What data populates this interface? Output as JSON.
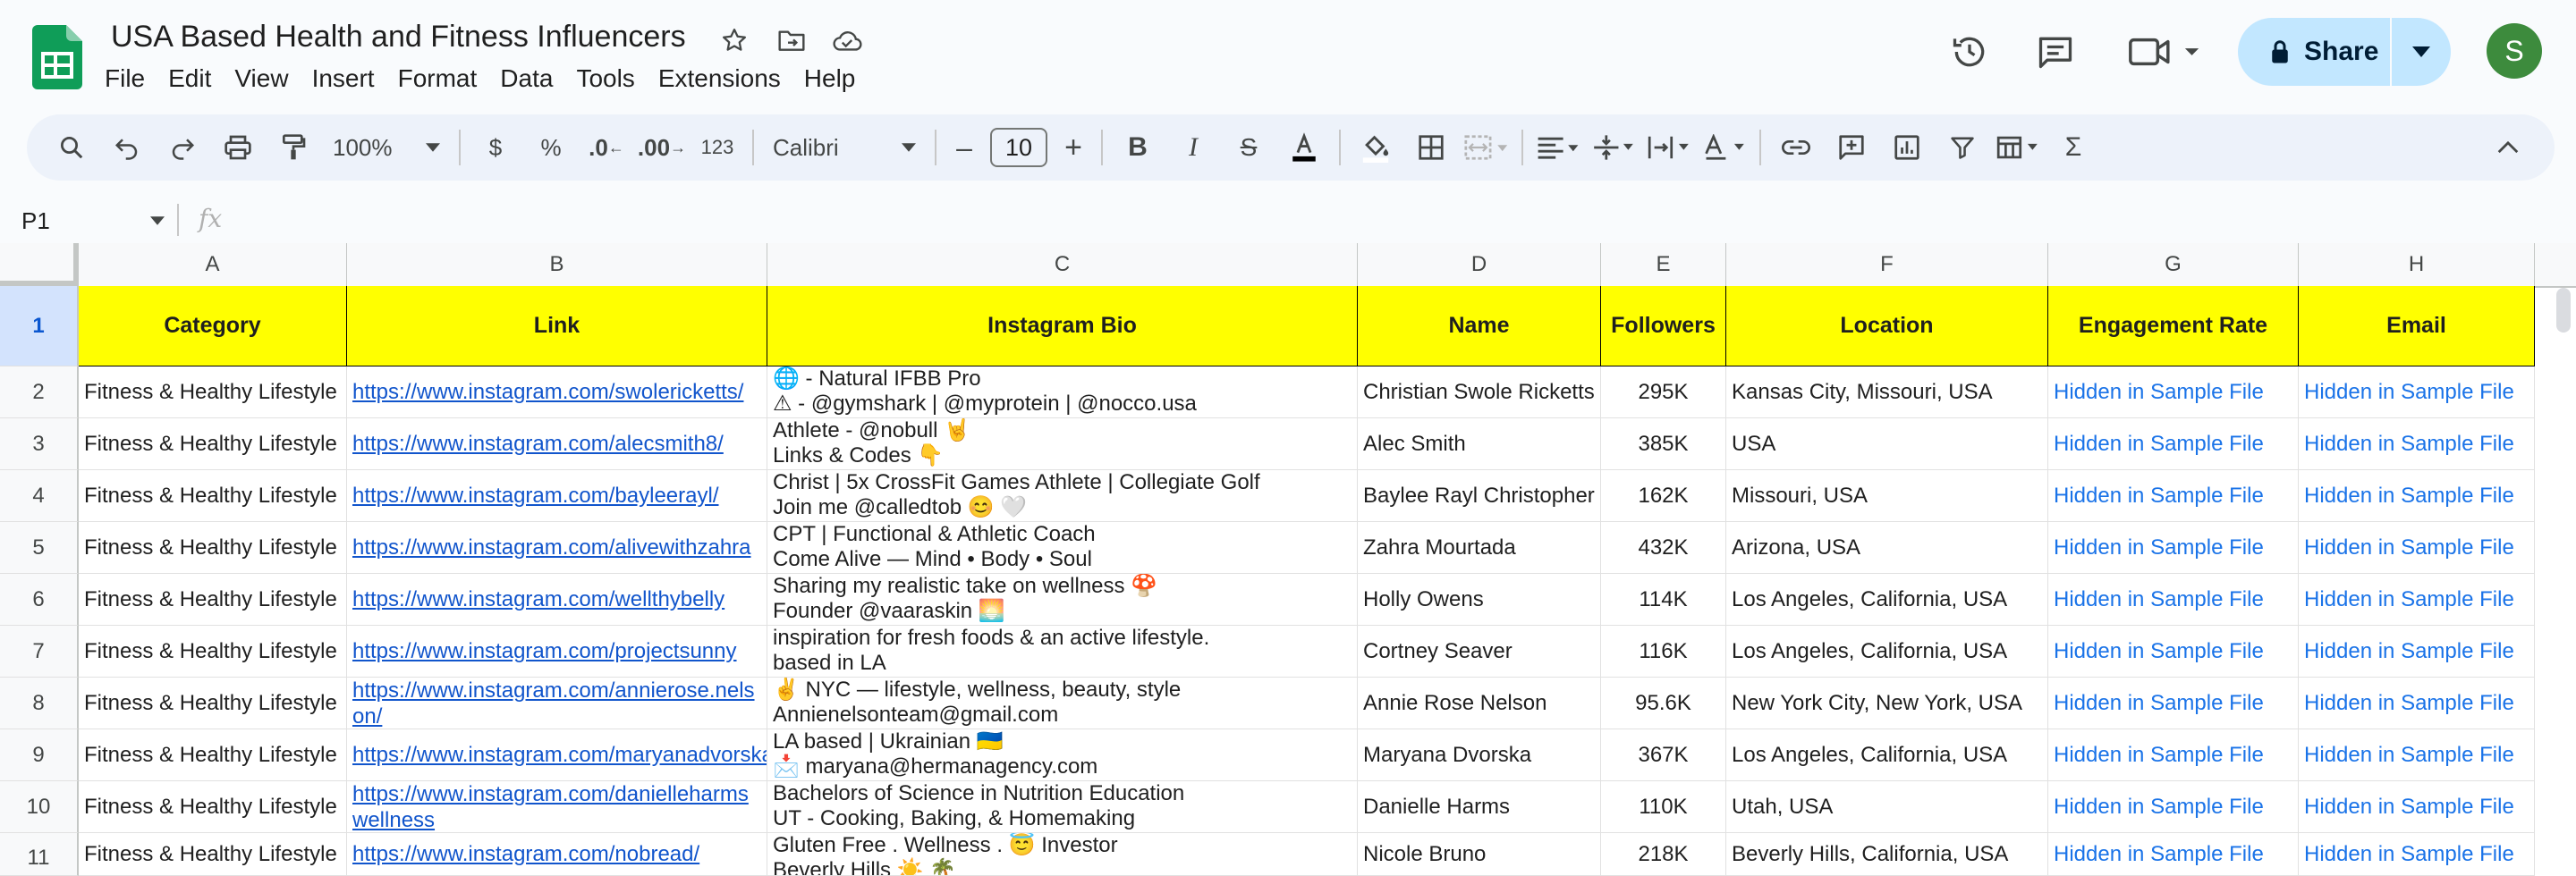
{
  "header": {
    "title": "USA Based Health and Fitness Influencers",
    "share_label": "Share",
    "avatar_letter": "S"
  },
  "menu": [
    "File",
    "Edit",
    "View",
    "Insert",
    "Format",
    "Data",
    "Tools",
    "Extensions",
    "Help"
  ],
  "toolbar": {
    "zoom": "100%",
    "currency": "$",
    "percent": "%",
    "dec_decrease": ".0",
    "dec_increase": ".00",
    "number_format": "123",
    "font": "Calibri",
    "font_size": "10",
    "minus": "–",
    "plus": "+"
  },
  "formula_bar": {
    "cell_ref": "P1",
    "fx": "fx"
  },
  "colors": {
    "header_fill": "#ffff00",
    "link": "#1155cc",
    "hidden_text": "#1a73e8",
    "share_bg": "#c2e7ff",
    "avatar_bg": "#3d8b3d"
  },
  "columns": [
    "A",
    "B",
    "C",
    "D",
    "E",
    "F",
    "G",
    "H"
  ],
  "row_numbers": [
    "1",
    "2",
    "3",
    "4",
    "5",
    "6",
    "7",
    "8",
    "9",
    "10",
    "11"
  ],
  "sheet": {
    "headers": [
      "Category",
      "Link",
      "Instagram Bio",
      "Name",
      "Followers",
      "Location",
      "Engagement Rate",
      "Email"
    ],
    "rows": [
      {
        "category": "Fitness & Healthy Lifestyle",
        "link": "https://www.instagram.com/swolericketts/",
        "bio1": "🌐 - Natural IFBB Pro",
        "bio2": "⚠ - @gymshark | @myprotein | @nocco.usa",
        "name": "Christian Swole Ricketts",
        "followers": "295K",
        "location": "Kansas City, Missouri, USA",
        "engagement": "Hidden in Sample File",
        "email": "Hidden in Sample File"
      },
      {
        "category": "Fitness & Healthy Lifestyle",
        "link": "https://www.instagram.com/alecsmith8/",
        "bio1": "Athlete - @nobull 🤘",
        "bio2": "Links & Codes 👇",
        "name": "Alec Smith",
        "followers": "385K",
        "location": "USA",
        "engagement": "Hidden in Sample File",
        "email": "Hidden in Sample File"
      },
      {
        "category": "Fitness & Healthy Lifestyle",
        "link": "https://www.instagram.com/bayleerayl/",
        "bio1": "Christ | 5x CrossFit Games Athlete | Collegiate Golf",
        "bio2": "Join me @calledtob 😊 🤍",
        "name": "Baylee Rayl Christopher",
        "followers": "162K",
        "location": "Missouri, USA",
        "engagement": "Hidden in Sample File",
        "email": "Hidden in Sample File"
      },
      {
        "category": "Fitness & Healthy Lifestyle",
        "link": "https://www.instagram.com/alivewithzahra",
        "bio1": "CPT | Functional & Athletic Coach",
        "bio2": "Come Alive — Mind • Body • Soul",
        "name": "Zahra Mourtada",
        "followers": "432K",
        "location": "Arizona, USA",
        "engagement": "Hidden in Sample File",
        "email": "Hidden in Sample File"
      },
      {
        "category": "Fitness & Healthy Lifestyle",
        "link": "https://www.instagram.com/wellthybelly",
        "bio1": "Sharing my realistic take on wellness 🍄",
        "bio2": "Founder @vaaraskin 🌅",
        "name": "Holly Owens",
        "followers": "114K",
        "location": "Los Angeles, California, USA",
        "engagement": "Hidden in Sample File",
        "email": "Hidden in Sample File"
      },
      {
        "category": "Fitness & Healthy Lifestyle",
        "link": "https://www.instagram.com/projectsunny",
        "bio1": "inspiration for fresh foods & an active lifestyle.",
        "bio2": "based in LA",
        "name": "Cortney Seaver",
        "followers": "116K",
        "location": "Los Angeles, California, USA",
        "engagement": "Hidden in Sample File",
        "email": "Hidden in Sample File"
      },
      {
        "category": "Fitness & Healthy Lifestyle",
        "link": "https://www.instagram.com/annierose.nelson/",
        "bio1": "✌ NYC — lifestyle, wellness, beauty, style",
        "bio2": "Annienelsonteam@gmail.com",
        "name": "Annie Rose Nelson",
        "followers": "95.6K",
        "location": "New York City, New York, USA",
        "engagement": "Hidden in Sample File",
        "email": "Hidden in Sample File"
      },
      {
        "category": "Fitness & Healthy Lifestyle",
        "link": "https://www.instagram.com/maryanadvorska/",
        "bio1": "LA based | Ukrainian 🇺🇦",
        "bio2": "📩 maryana@hermanagency.com",
        "name": "Maryana Dvorska",
        "followers": "367K",
        "location": "Los Angeles, California, USA",
        "engagement": "Hidden in Sample File",
        "email": "Hidden in Sample File"
      },
      {
        "category": "Fitness & Healthy Lifestyle",
        "link": "https://www.instagram.com/danielleharmswellness",
        "bio1": "Bachelors of Science in Nutrition Education",
        "bio2": "UT - Cooking, Baking, & Homemaking",
        "name": "Danielle Harms",
        "followers": "110K",
        "location": "Utah, USA",
        "engagement": "Hidden in Sample File",
        "email": "Hidden in Sample File"
      },
      {
        "category": "Fitness & Healthy Lifestyle",
        "link": "https://www.instagram.com/nobread/",
        "bio1": "Gluten Free . Wellness . 😇 Investor",
        "bio2": "Beverly Hills ☀️ 🌴",
        "name": "Nicole Bruno",
        "followers": "218K",
        "location": "Beverly Hills, California, USA",
        "engagement": "Hidden in Sample File",
        "email": "Hidden in Sample File"
      }
    ]
  }
}
